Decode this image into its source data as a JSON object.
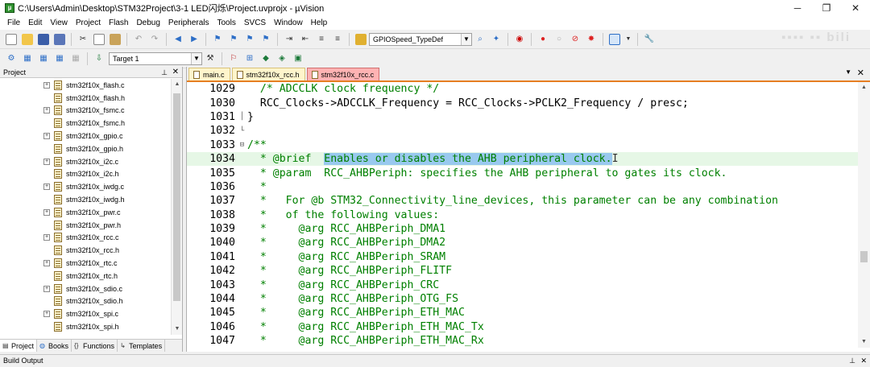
{
  "window": {
    "title": "C:\\Users\\Admin\\Desktop\\STM32Project\\3-1 LED闪烁\\Project.uvprojx - µVision",
    "minimize": "─",
    "maximize": "❐",
    "close": "✕"
  },
  "menu": [
    "File",
    "Edit",
    "View",
    "Project",
    "Flash",
    "Debug",
    "Peripherals",
    "Tools",
    "SVCS",
    "Window",
    "Help"
  ],
  "toolbar": {
    "find_combo": "GPIOSpeed_TypeDef",
    "target_combo": "Target 1"
  },
  "project_panel": {
    "title": "Project",
    "files": [
      {
        "name": "stm32f10x_flash.c",
        "expandable": true
      },
      {
        "name": "stm32f10x_flash.h",
        "expandable": false
      },
      {
        "name": "stm32f10x_fsmc.c",
        "expandable": true
      },
      {
        "name": "stm32f10x_fsmc.h",
        "expandable": false
      },
      {
        "name": "stm32f10x_gpio.c",
        "expandable": true
      },
      {
        "name": "stm32f10x_gpio.h",
        "expandable": false
      },
      {
        "name": "stm32f10x_i2c.c",
        "expandable": true
      },
      {
        "name": "stm32f10x_i2c.h",
        "expandable": false
      },
      {
        "name": "stm32f10x_iwdg.c",
        "expandable": true
      },
      {
        "name": "stm32f10x_iwdg.h",
        "expandable": false
      },
      {
        "name": "stm32f10x_pwr.c",
        "expandable": true
      },
      {
        "name": "stm32f10x_pwr.h",
        "expandable": false
      },
      {
        "name": "stm32f10x_rcc.c",
        "expandable": true
      },
      {
        "name": "stm32f10x_rcc.h",
        "expandable": false
      },
      {
        "name": "stm32f10x_rtc.c",
        "expandable": true
      },
      {
        "name": "stm32f10x_rtc.h",
        "expandable": false
      },
      {
        "name": "stm32f10x_sdio.c",
        "expandable": true
      },
      {
        "name": "stm32f10x_sdio.h",
        "expandable": false
      },
      {
        "name": "stm32f10x_spi.c",
        "expandable": true
      },
      {
        "name": "stm32f10x_spi.h",
        "expandable": false
      }
    ],
    "tabs": [
      "Project",
      "Books",
      "Functions",
      "Templates"
    ]
  },
  "editor": {
    "tabs": [
      {
        "label": "main.c",
        "active": false
      },
      {
        "label": "stm32f10x_rcc.h",
        "active": false
      },
      {
        "label": "stm32f10x_rcc.c",
        "active": true
      }
    ],
    "lines": [
      {
        "num": "1029",
        "fold": "",
        "cur": false,
        "segs": [
          {
            "t": "  ",
            "k": ""
          },
          {
            "t": "/* ADCCLK clock frequency */",
            "k": "c"
          }
        ]
      },
      {
        "num": "1030",
        "fold": "",
        "cur": false,
        "segs": [
          {
            "t": "  RCC_Clocks->ADCCLK_Frequency = RCC_Clocks->PCLK2_Frequency / presc;",
            "k": ""
          }
        ]
      },
      {
        "num": "1031",
        "fold": "│",
        "cur": false,
        "segs": [
          {
            "t": "}",
            "k": ""
          }
        ]
      },
      {
        "num": "1032",
        "fold": "└",
        "cur": false,
        "segs": [
          {
            "t": "",
            "k": ""
          }
        ]
      },
      {
        "num": "1033",
        "fold": "⊟",
        "cur": false,
        "segs": [
          {
            "t": "/**",
            "k": "c"
          }
        ]
      },
      {
        "num": "1034",
        "fold": "",
        "cur": true,
        "segs": [
          {
            "t": "  * @brief  ",
            "k": "c"
          },
          {
            "t": "Enables or disables the AHB peripheral clock.",
            "k": "sel"
          },
          {
            "t": "I",
            "k": "caret"
          }
        ]
      },
      {
        "num": "1035",
        "fold": "",
        "cur": false,
        "segs": [
          {
            "t": "  * @param  RCC_AHBPeriph: specifies the AHB peripheral to gates its clock.",
            "k": "c"
          }
        ]
      },
      {
        "num": "1036",
        "fold": "",
        "cur": false,
        "segs": [
          {
            "t": "  *",
            "k": "c"
          }
        ]
      },
      {
        "num": "1037",
        "fold": "",
        "cur": false,
        "segs": [
          {
            "t": "  *   For @b STM32_Connectivity_line_devices, this parameter can be any combination",
            "k": "c"
          }
        ]
      },
      {
        "num": "1038",
        "fold": "",
        "cur": false,
        "segs": [
          {
            "t": "  *   of the following values:",
            "k": "c"
          }
        ]
      },
      {
        "num": "1039",
        "fold": "",
        "cur": false,
        "segs": [
          {
            "t": "  *     @arg RCC_AHBPeriph_DMA1",
            "k": "c"
          }
        ]
      },
      {
        "num": "1040",
        "fold": "",
        "cur": false,
        "segs": [
          {
            "t": "  *     @arg RCC_AHBPeriph_DMA2",
            "k": "c"
          }
        ]
      },
      {
        "num": "1041",
        "fold": "",
        "cur": false,
        "segs": [
          {
            "t": "  *     @arg RCC_AHBPeriph_SRAM",
            "k": "c"
          }
        ]
      },
      {
        "num": "1042",
        "fold": "",
        "cur": false,
        "segs": [
          {
            "t": "  *     @arg RCC_AHBPeriph_FLITF",
            "k": "c"
          }
        ]
      },
      {
        "num": "1043",
        "fold": "",
        "cur": false,
        "segs": [
          {
            "t": "  *     @arg RCC_AHBPeriph_CRC",
            "k": "c"
          }
        ]
      },
      {
        "num": "1044",
        "fold": "",
        "cur": false,
        "segs": [
          {
            "t": "  *     @arg RCC_AHBPeriph_OTG_FS",
            "k": "c"
          }
        ]
      },
      {
        "num": "1045",
        "fold": "",
        "cur": false,
        "segs": [
          {
            "t": "  *     @arg RCC_AHBPeriph_ETH_MAC",
            "k": "c"
          }
        ]
      },
      {
        "num": "1046",
        "fold": "",
        "cur": false,
        "segs": [
          {
            "t": "  *     @arg RCC_AHBPeriph_ETH_MAC_Tx",
            "k": "c"
          }
        ]
      },
      {
        "num": "1047",
        "fold": "",
        "cur": false,
        "segs": [
          {
            "t": "  *     @arg RCC_AHBPeriph_ETH_MAC_Rx",
            "k": "c"
          }
        ]
      }
    ]
  },
  "build_output": {
    "title": "Build Output"
  },
  "colors": {
    "selection": "#99c9ef",
    "comment": "#008000",
    "current_line": "#e6f7e6",
    "active_tab": "#ffb3b3",
    "tab": "#fff5cc"
  }
}
